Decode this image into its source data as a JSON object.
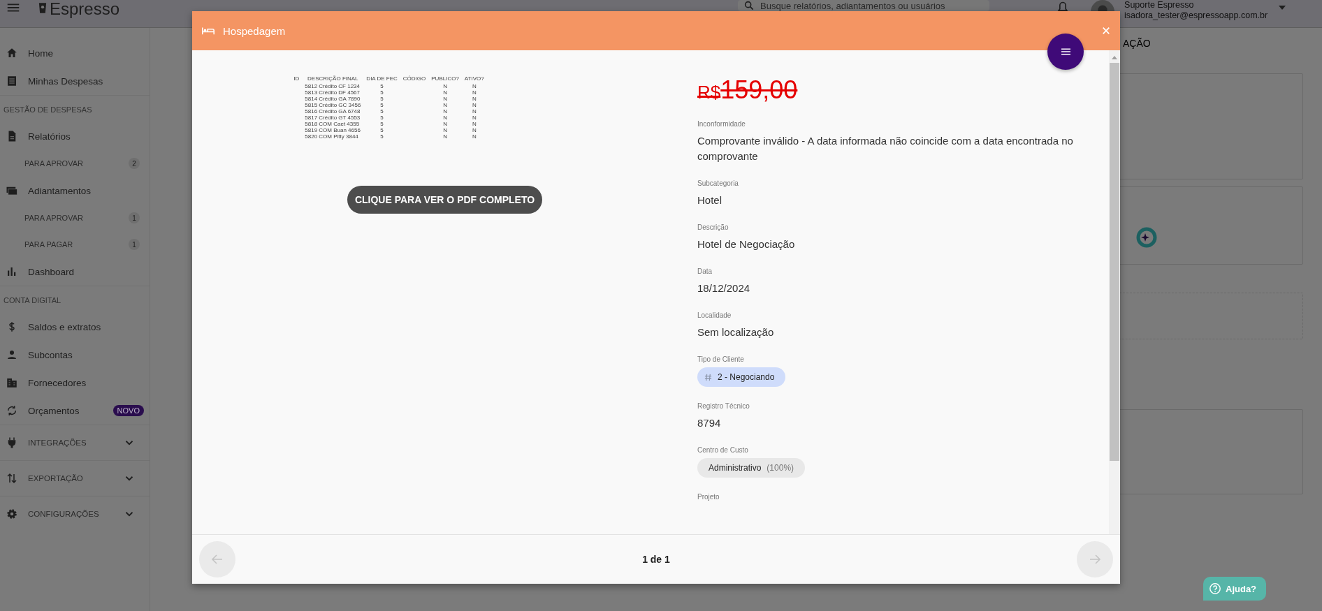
{
  "app_bar": {
    "brand": "Espresso",
    "search": {
      "placeholder": "Busque relatórios, adiantamentos ou usuários"
    },
    "user": {
      "name": "Suporte Espresso",
      "email": "isadora_tester@espressoapp.com.br"
    }
  },
  "sidebar": {
    "items": [
      {
        "kind": "item",
        "label": "Home"
      },
      {
        "kind": "item",
        "label": "Minhas Despesas"
      },
      {
        "kind": "section",
        "label": "GESTÃO DE DESPESAS"
      },
      {
        "kind": "item",
        "label": "Relatórios"
      },
      {
        "kind": "subitem",
        "label": "PARA APROVAR",
        "count": "2"
      },
      {
        "kind": "item",
        "label": "Adiantamentos"
      },
      {
        "kind": "subitem",
        "label": "PARA APROVAR",
        "count": "1"
      },
      {
        "kind": "subitem",
        "label": "PARA PAGAR",
        "count": "1"
      },
      {
        "kind": "item",
        "label": "Dashboard"
      },
      {
        "kind": "section",
        "label": "CONTA DIGITAL"
      },
      {
        "kind": "item",
        "label": "Saldos e extratos"
      },
      {
        "kind": "item",
        "label": "Subcontas"
      },
      {
        "kind": "item",
        "label": "Fornecedores"
      },
      {
        "kind": "item",
        "label": "Orçamentos",
        "badge": "NOVO"
      },
      {
        "kind": "group",
        "label": "INTEGRAÇÕES",
        "expanded": false
      },
      {
        "kind": "group",
        "label": "EXPORTAÇÃO",
        "expanded": false
      },
      {
        "kind": "group",
        "label": "CONFIGURAÇÕES",
        "expanded": false
      }
    ]
  },
  "background": {
    "heading_fragment": "AÇÃO"
  },
  "modal": {
    "title": "Hospedagem",
    "receipt": {
      "columns": [
        "ID",
        "DESCRIÇÃO FINAL",
        "DIA DE FEC",
        "CÓDIGO",
        "PUBLICO?",
        "ATIVO?"
      ],
      "rows": [
        [
          "",
          "5812 Crédito CF 1234",
          "5",
          "",
          "N",
          "N"
        ],
        [
          "",
          "5813 Crédito DF 4567",
          "5",
          "",
          "N",
          "N"
        ],
        [
          "",
          "5814 Crédito GA 7890",
          "5",
          "",
          "N",
          "N"
        ],
        [
          "",
          "5815 Crédito GC 3456",
          "5",
          "",
          "N",
          "N"
        ],
        [
          "",
          "5816 Crédito GA 6748",
          "5",
          "",
          "N",
          "N"
        ],
        [
          "",
          "5817 Crédito GT 4553",
          "5",
          "",
          "N",
          "N"
        ],
        [
          "",
          "5818 COM Caet 4355",
          "5",
          "",
          "N",
          "N"
        ],
        [
          "",
          "5819 COM Buan 4656",
          "5",
          "",
          "N",
          "N"
        ],
        [
          "",
          "5820 COM Pitty 3844",
          "5",
          "",
          "N",
          "N"
        ]
      ]
    },
    "pdf_button": "CLIQUE PARA VER O PDF COMPLETO",
    "price": {
      "currency": "R$",
      "amount": "159,00",
      "strikethrough": true
    },
    "fields": [
      {
        "kind": "text",
        "label": "Inconformidade",
        "value": "Comprovante inválido - A data informada não coincide com a data encontrada no comprovante"
      },
      {
        "kind": "text",
        "label": "Subcategoria",
        "value": "Hotel"
      },
      {
        "kind": "text",
        "label": "Descrição",
        "value": "Hotel de Negociação"
      },
      {
        "kind": "text",
        "label": "Data",
        "value": "18/12/2024"
      },
      {
        "kind": "text",
        "label": "Localidade",
        "value": "Sem localização"
      },
      {
        "kind": "tag",
        "label": "Tipo de Cliente",
        "value": "2 - Negociando"
      },
      {
        "kind": "text",
        "label": "Registro Técnico",
        "value": "8794"
      },
      {
        "kind": "share",
        "label": "Centro de Custo",
        "value": "Administrativo",
        "share": "(100%)"
      },
      {
        "kind": "text",
        "label": "Projeto"
      }
    ],
    "pager": {
      "text": "1 de 1",
      "prev_disabled": true,
      "next_disabled": true
    }
  },
  "help_button": "Ajuda?"
}
